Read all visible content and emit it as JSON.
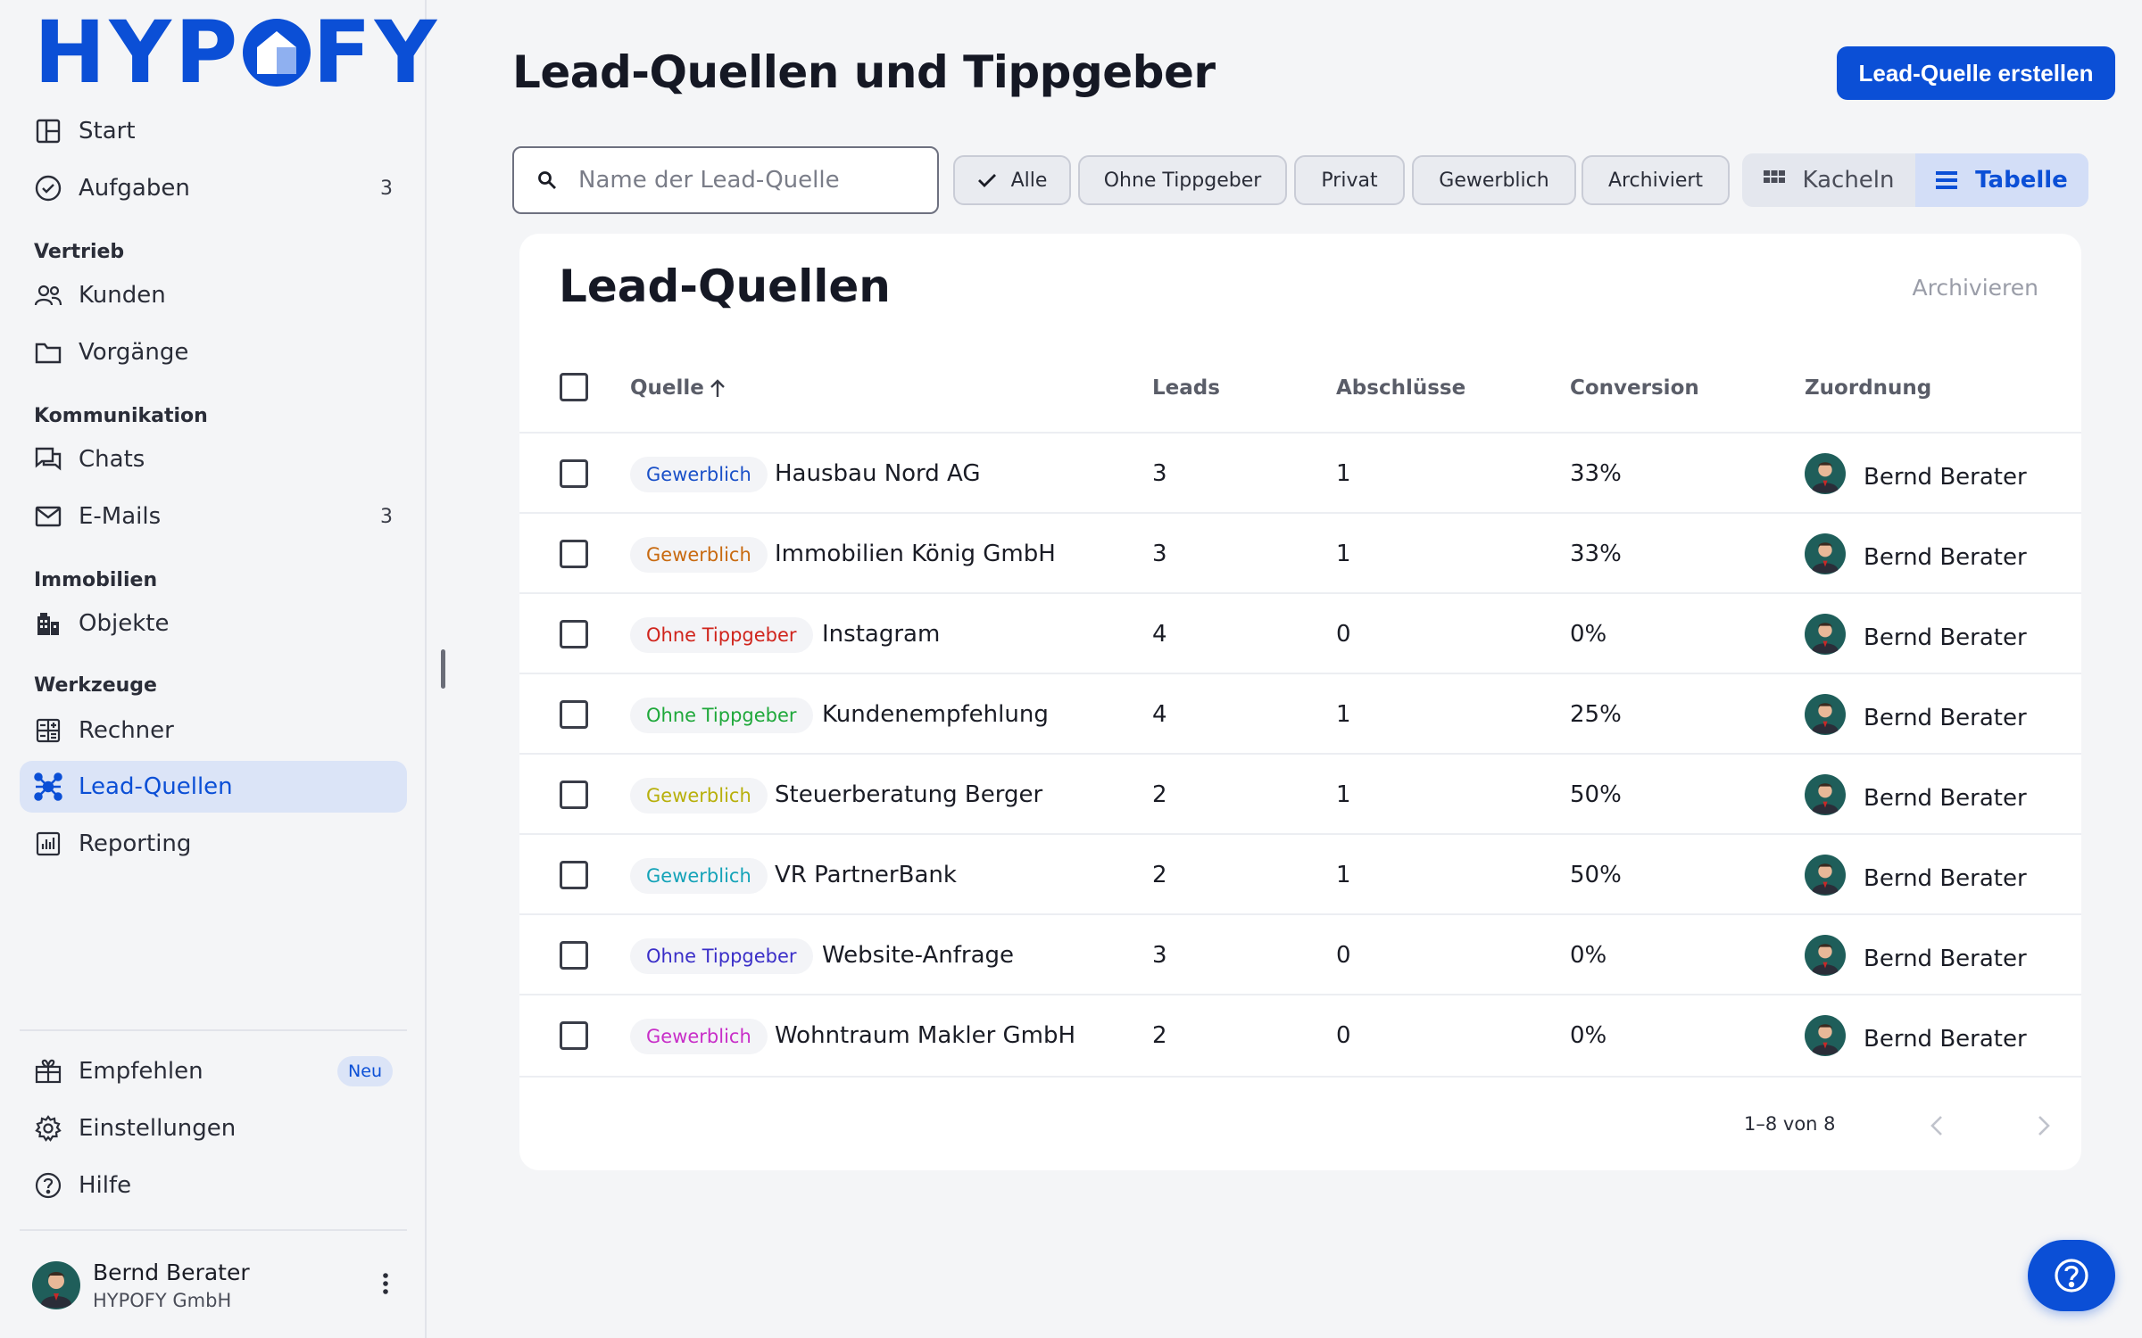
{
  "app": {
    "logo_text_left": "HYP",
    "logo_text_right": "FY",
    "brand_color": "#0b4fd6"
  },
  "sidebar": {
    "top_items": [
      {
        "label": "Start",
        "icon": "dashboard-icon"
      },
      {
        "label": "Aufgaben",
        "icon": "check-circle-icon",
        "count": "3"
      }
    ],
    "sections": [
      {
        "title": "Vertrieb",
        "items": [
          {
            "label": "Kunden",
            "icon": "people-icon"
          },
          {
            "label": "Vorgänge",
            "icon": "folder-icon"
          }
        ]
      },
      {
        "title": "Kommunikation",
        "items": [
          {
            "label": "Chats",
            "icon": "chat-icon"
          },
          {
            "label": "E-Mails",
            "icon": "mail-icon",
            "count": "3"
          }
        ]
      },
      {
        "title": "Immobilien",
        "items": [
          {
            "label": "Objekte",
            "icon": "building-icon"
          }
        ]
      },
      {
        "title": "Werkzeuge",
        "items": [
          {
            "label": "Rechner",
            "icon": "calculator-icon"
          },
          {
            "label": "Lead-Quellen",
            "icon": "network-icon",
            "active": true
          },
          {
            "label": "Reporting",
            "icon": "chart-icon"
          }
        ]
      }
    ],
    "bottom_items": [
      {
        "label": "Empfehlen",
        "icon": "gift-icon",
        "badge": "Neu"
      },
      {
        "label": "Einstellungen",
        "icon": "gear-icon"
      },
      {
        "label": "Hilfe",
        "icon": "help-circle-icon"
      }
    ],
    "profile": {
      "name": "Bernd Berater",
      "company": "HYPOFY GmbH"
    }
  },
  "header": {
    "title": "Lead-Quellen und Tippgeber",
    "create_button": "Lead-Quelle erstellen"
  },
  "filters": {
    "search_placeholder": "Name der Lead-Quelle",
    "chips": [
      "Alle",
      "Ohne Tippgeber",
      "Privat",
      "Gewerblich",
      "Archiviert"
    ],
    "active_chip": "Alle",
    "view_options": [
      "Kacheln",
      "Tabelle"
    ],
    "active_view": "Tabelle"
  },
  "table": {
    "title": "Lead-Quellen",
    "action": "Archivieren",
    "columns": {
      "source": "Quelle",
      "leads": "Leads",
      "closings": "Abschlüsse",
      "conversion": "Conversion",
      "assignment": "Zuordnung"
    },
    "rows": [
      {
        "tag": "Gewerblich",
        "tag_color": "#1a50c8",
        "name": "Hausbau Nord AG",
        "leads": "3",
        "closings": "1",
        "conversion": "33%",
        "assignee": "Bernd Berater"
      },
      {
        "tag": "Gewerblich",
        "tag_color": "#c86a10",
        "name": "Immobilien König GmbH",
        "leads": "3",
        "closings": "1",
        "conversion": "33%",
        "assignee": "Bernd Berater"
      },
      {
        "tag": "Ohne Tippgeber",
        "tag_color": "#d0241c",
        "name": "Instagram",
        "leads": "4",
        "closings": "0",
        "conversion": "0%",
        "assignee": "Bernd Berater"
      },
      {
        "tag": "Ohne Tippgeber",
        "tag_color": "#1ea83a",
        "name": "Kundenempfehlung",
        "leads": "4",
        "closings": "1",
        "conversion": "25%",
        "assignee": "Bernd Berater"
      },
      {
        "tag": "Gewerblich",
        "tag_color": "#b8b00c",
        "name": "Steuerberatung Berger",
        "leads": "2",
        "closings": "1",
        "conversion": "50%",
        "assignee": "Bernd Berater"
      },
      {
        "tag": "Gewerblich",
        "tag_color": "#14a3b8",
        "name": "VR PartnerBank",
        "leads": "2",
        "closings": "1",
        "conversion": "50%",
        "assignee": "Bernd Berater"
      },
      {
        "tag": "Ohne Tippgeber",
        "tag_color": "#3a2ec8",
        "name": "Website-Anfrage",
        "leads": "3",
        "closings": "0",
        "conversion": "0%",
        "assignee": "Bernd Berater"
      },
      {
        "tag": "Gewerblich",
        "tag_color": "#c82ec8",
        "name": "Wohntraum Makler GmbH",
        "leads": "2",
        "closings": "0",
        "conversion": "0%",
        "assignee": "Bernd Berater"
      }
    ],
    "pagination": "1–8 von 8"
  }
}
